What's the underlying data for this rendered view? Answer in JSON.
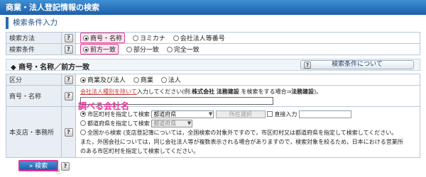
{
  "page_title": "商業・法人登記情報の検索",
  "section_title": "検索条件入力",
  "help_glyph": "?",
  "method_row": {
    "label": "検索方法",
    "options": [
      "商号・名称",
      "ヨミカナ",
      "会社法人等番号"
    ],
    "selected": 0
  },
  "condition_row": {
    "label": "検索条件",
    "options": [
      "前方一致",
      "部分一致",
      "完全一致"
    ],
    "selected": 0
  },
  "sub_header": {
    "title": "商号・名称／前方一致",
    "about_button": "検索条件について"
  },
  "kubun_row": {
    "label": "区分",
    "options": [
      "商業及び法人",
      "商業",
      "法人"
    ],
    "selected": 0
  },
  "name_row": {
    "label": "商号・名称",
    "instruction_link": "会社法人種別を除いて",
    "instruction_mid": "入力してください(例:",
    "example_bold_1": "株式会社 法務建設",
    "instruction_mid2": "を検索をする場合⇒",
    "example_bold_2": "法務建設",
    "instruction_end": ")。",
    "input_value": "",
    "annotation": "調べる会社名"
  },
  "office_row": {
    "label": "本支店・事務所",
    "opt1_label": "市区町村を指定して検索",
    "opt1_select": "都道府県",
    "opt1_locate_button": "所在選択",
    "opt1_direct_label": "直接入力",
    "opt2_label": "都道府県を指定して検索",
    "opt2_select": "都道府県",
    "opt3_text_line1": "全国から検索 (支店登記簿については，全国検索の対象外ですので，市区町村又は都道府県を指定して検索してください。",
    "opt3_text_line2": "また，外国会社については，同じ会社法人等が複数表示される場合がありますので，検索対象を絞るため，日本における営業所",
    "opt3_text_line3": "のある市区町村を指定して検索してください。",
    "selected": 0
  },
  "search_button": "» 検索"
}
